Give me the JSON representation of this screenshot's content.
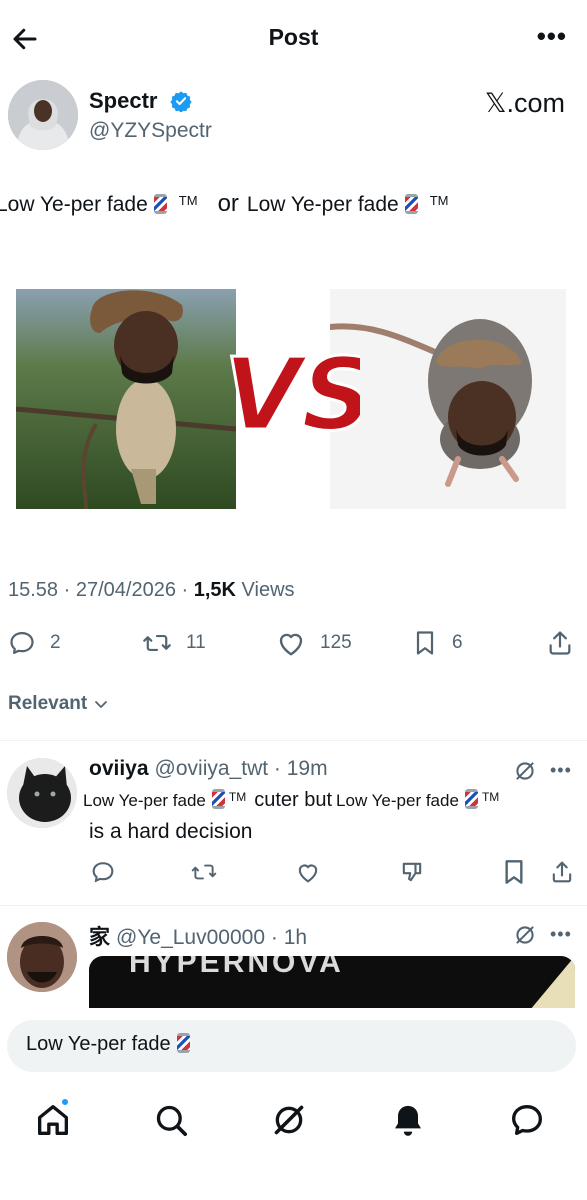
{
  "header": {
    "back_icon": "arrow-left-icon",
    "title": "Post",
    "more_icon": "more-horizontal-icon"
  },
  "author": {
    "name": "Spectr",
    "handle": "@YZYSpectr",
    "verified_icon": "verified-badge-icon",
    "watermark": "𝕏.com"
  },
  "tweet": {
    "text_part1": "Low Ye-per fade",
    "tm1": "TM",
    "or": "or",
    "text_part2": "Low Ye-per fade",
    "tm2": "TM",
    "image_left_desc": "bird",
    "image_right_desc": "rat",
    "vs_text": "VS"
  },
  "meta": {
    "time": "15.58",
    "date": "27/04/2026",
    "views_count": "1,5K",
    "views_label": "Views",
    "sep": " · "
  },
  "actions": {
    "replies": "2",
    "reposts": "11",
    "likes": "125",
    "bookmarks": "6"
  },
  "sort": {
    "label": "Relevant"
  },
  "replies": [
    {
      "name": "oviiya",
      "handle": "@oviiya_twt",
      "time": "19m",
      "text_a": "Low Ye-per fade",
      "tm_a": "TM",
      "text_mid": "cuter but",
      "text_b": "Low Ye-per fade",
      "tm_b": "TM",
      "text_line2": "is a hard decision"
    },
    {
      "name": "家",
      "handle": "@Ye_Luv00000",
      "time": "1h",
      "media_text": "HYPERNOVA"
    }
  ],
  "compose": {
    "value": "Low Ye-per fade"
  },
  "nav": {
    "items": [
      "home-icon",
      "search-icon",
      "grok-icon",
      "notifications-icon",
      "messages-icon"
    ]
  },
  "colors": {
    "accent": "#1d9bf0",
    "secondary_text": "#536471",
    "primary_text": "#0f1419",
    "vs_red": "#c1141a"
  }
}
